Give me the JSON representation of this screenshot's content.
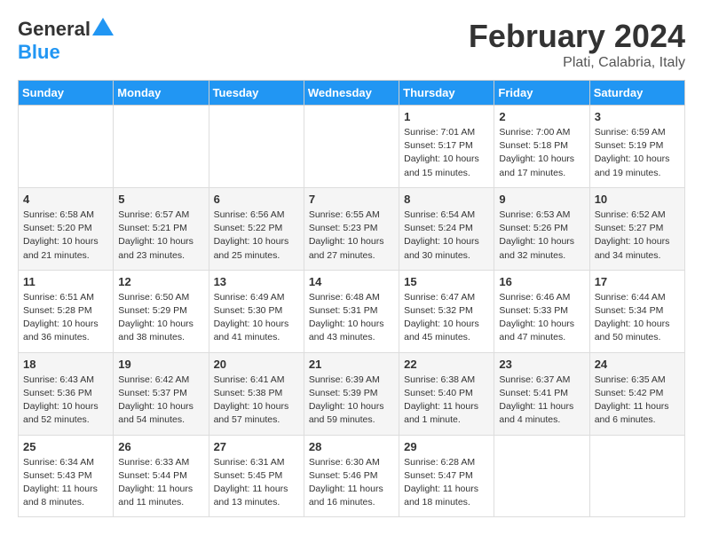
{
  "header": {
    "logo_general": "General",
    "logo_blue": "Blue",
    "month": "February 2024",
    "location": "Plati, Calabria, Italy"
  },
  "days_of_week": [
    "Sunday",
    "Monday",
    "Tuesday",
    "Wednesday",
    "Thursday",
    "Friday",
    "Saturday"
  ],
  "weeks": [
    [
      {
        "day": "",
        "info": ""
      },
      {
        "day": "",
        "info": ""
      },
      {
        "day": "",
        "info": ""
      },
      {
        "day": "",
        "info": ""
      },
      {
        "day": "1",
        "info": "Sunrise: 7:01 AM\nSunset: 5:17 PM\nDaylight: 10 hours\nand 15 minutes."
      },
      {
        "day": "2",
        "info": "Sunrise: 7:00 AM\nSunset: 5:18 PM\nDaylight: 10 hours\nand 17 minutes."
      },
      {
        "day": "3",
        "info": "Sunrise: 6:59 AM\nSunset: 5:19 PM\nDaylight: 10 hours\nand 19 minutes."
      }
    ],
    [
      {
        "day": "4",
        "info": "Sunrise: 6:58 AM\nSunset: 5:20 PM\nDaylight: 10 hours\nand 21 minutes."
      },
      {
        "day": "5",
        "info": "Sunrise: 6:57 AM\nSunset: 5:21 PM\nDaylight: 10 hours\nand 23 minutes."
      },
      {
        "day": "6",
        "info": "Sunrise: 6:56 AM\nSunset: 5:22 PM\nDaylight: 10 hours\nand 25 minutes."
      },
      {
        "day": "7",
        "info": "Sunrise: 6:55 AM\nSunset: 5:23 PM\nDaylight: 10 hours\nand 27 minutes."
      },
      {
        "day": "8",
        "info": "Sunrise: 6:54 AM\nSunset: 5:24 PM\nDaylight: 10 hours\nand 30 minutes."
      },
      {
        "day": "9",
        "info": "Sunrise: 6:53 AM\nSunset: 5:26 PM\nDaylight: 10 hours\nand 32 minutes."
      },
      {
        "day": "10",
        "info": "Sunrise: 6:52 AM\nSunset: 5:27 PM\nDaylight: 10 hours\nand 34 minutes."
      }
    ],
    [
      {
        "day": "11",
        "info": "Sunrise: 6:51 AM\nSunset: 5:28 PM\nDaylight: 10 hours\nand 36 minutes."
      },
      {
        "day": "12",
        "info": "Sunrise: 6:50 AM\nSunset: 5:29 PM\nDaylight: 10 hours\nand 38 minutes."
      },
      {
        "day": "13",
        "info": "Sunrise: 6:49 AM\nSunset: 5:30 PM\nDaylight: 10 hours\nand 41 minutes."
      },
      {
        "day": "14",
        "info": "Sunrise: 6:48 AM\nSunset: 5:31 PM\nDaylight: 10 hours\nand 43 minutes."
      },
      {
        "day": "15",
        "info": "Sunrise: 6:47 AM\nSunset: 5:32 PM\nDaylight: 10 hours\nand 45 minutes."
      },
      {
        "day": "16",
        "info": "Sunrise: 6:46 AM\nSunset: 5:33 PM\nDaylight: 10 hours\nand 47 minutes."
      },
      {
        "day": "17",
        "info": "Sunrise: 6:44 AM\nSunset: 5:34 PM\nDaylight: 10 hours\nand 50 minutes."
      }
    ],
    [
      {
        "day": "18",
        "info": "Sunrise: 6:43 AM\nSunset: 5:36 PM\nDaylight: 10 hours\nand 52 minutes."
      },
      {
        "day": "19",
        "info": "Sunrise: 6:42 AM\nSunset: 5:37 PM\nDaylight: 10 hours\nand 54 minutes."
      },
      {
        "day": "20",
        "info": "Sunrise: 6:41 AM\nSunset: 5:38 PM\nDaylight: 10 hours\nand 57 minutes."
      },
      {
        "day": "21",
        "info": "Sunrise: 6:39 AM\nSunset: 5:39 PM\nDaylight: 10 hours\nand 59 minutes."
      },
      {
        "day": "22",
        "info": "Sunrise: 6:38 AM\nSunset: 5:40 PM\nDaylight: 11 hours\nand 1 minute."
      },
      {
        "day": "23",
        "info": "Sunrise: 6:37 AM\nSunset: 5:41 PM\nDaylight: 11 hours\nand 4 minutes."
      },
      {
        "day": "24",
        "info": "Sunrise: 6:35 AM\nSunset: 5:42 PM\nDaylight: 11 hours\nand 6 minutes."
      }
    ],
    [
      {
        "day": "25",
        "info": "Sunrise: 6:34 AM\nSunset: 5:43 PM\nDaylight: 11 hours\nand 8 minutes."
      },
      {
        "day": "26",
        "info": "Sunrise: 6:33 AM\nSunset: 5:44 PM\nDaylight: 11 hours\nand 11 minutes."
      },
      {
        "day": "27",
        "info": "Sunrise: 6:31 AM\nSunset: 5:45 PM\nDaylight: 11 hours\nand 13 minutes."
      },
      {
        "day": "28",
        "info": "Sunrise: 6:30 AM\nSunset: 5:46 PM\nDaylight: 11 hours\nand 16 minutes."
      },
      {
        "day": "29",
        "info": "Sunrise: 6:28 AM\nSunset: 5:47 PM\nDaylight: 11 hours\nand 18 minutes."
      },
      {
        "day": "",
        "info": ""
      },
      {
        "day": "",
        "info": ""
      }
    ]
  ]
}
